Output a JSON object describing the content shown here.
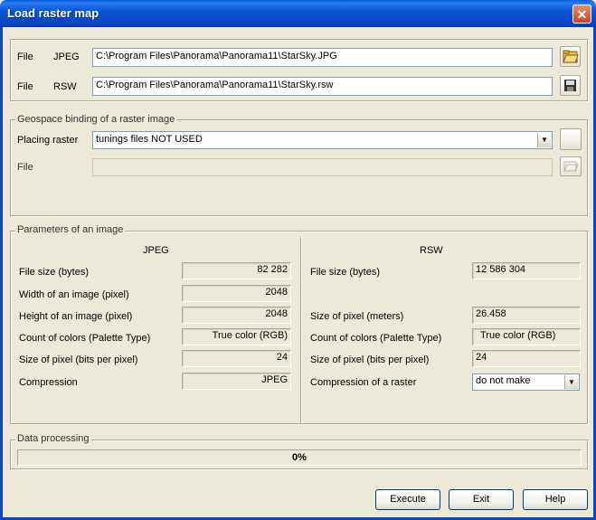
{
  "window": {
    "title": "Load raster map",
    "close_glyph": "✕"
  },
  "files": {
    "jpeg": {
      "label": "File",
      "type": "JPEG",
      "path": "C:\\Program Files\\Panorama\\Panorama11\\StarSky.JPG"
    },
    "rsw": {
      "label": "File",
      "type": "RSW",
      "path": "C:\\Program Files\\Panorama\\Panorama11\\StarSky.rsw"
    }
  },
  "geospace": {
    "legend": "Geospace binding of a raster image",
    "placing_label": "Placing raster",
    "placing_value": "tunings files NOT USED",
    "file_label": "File",
    "file_value": ""
  },
  "params": {
    "legend": "Parameters of an image",
    "jpeg": {
      "header": "JPEG",
      "file_size_label": "File size (bytes)",
      "file_size": "82 282",
      "width_label": "Width of an image (pixel)",
      "width": "2048",
      "height_label": "Height of an image (pixel)",
      "height": "2048",
      "colors_label": "Count of colors (Palette Type)",
      "colors": "True color (RGB)",
      "bpp_label": "Size of pixel (bits per pixel)",
      "bpp": "24",
      "compression_label": "Compression",
      "compression": "JPEG"
    },
    "rsw": {
      "header": "RSW",
      "file_size_label": "File size (bytes)",
      "file_size": "12 586 304",
      "pixel_meters_label": "Size of pixel (meters)",
      "pixel_meters": "26.458",
      "colors_label": "Count of colors (Palette Type)",
      "colors": "True color (RGB)",
      "bpp_label": "Size of pixel (bits per pixel)",
      "bpp": "24",
      "compression_label": "Compression of a raster",
      "compression": "do not make"
    }
  },
  "processing": {
    "legend": "Data processing",
    "progress_text": "0%",
    "progress_fraction": 0
  },
  "buttons": {
    "execute": "Execute",
    "exit": "Exit",
    "help": "Help"
  },
  "colors": {
    "title_bar": "#0b56d6",
    "close_button": "#c9431f",
    "background": "#ece9d8",
    "progress_fill": "#316ac5"
  }
}
